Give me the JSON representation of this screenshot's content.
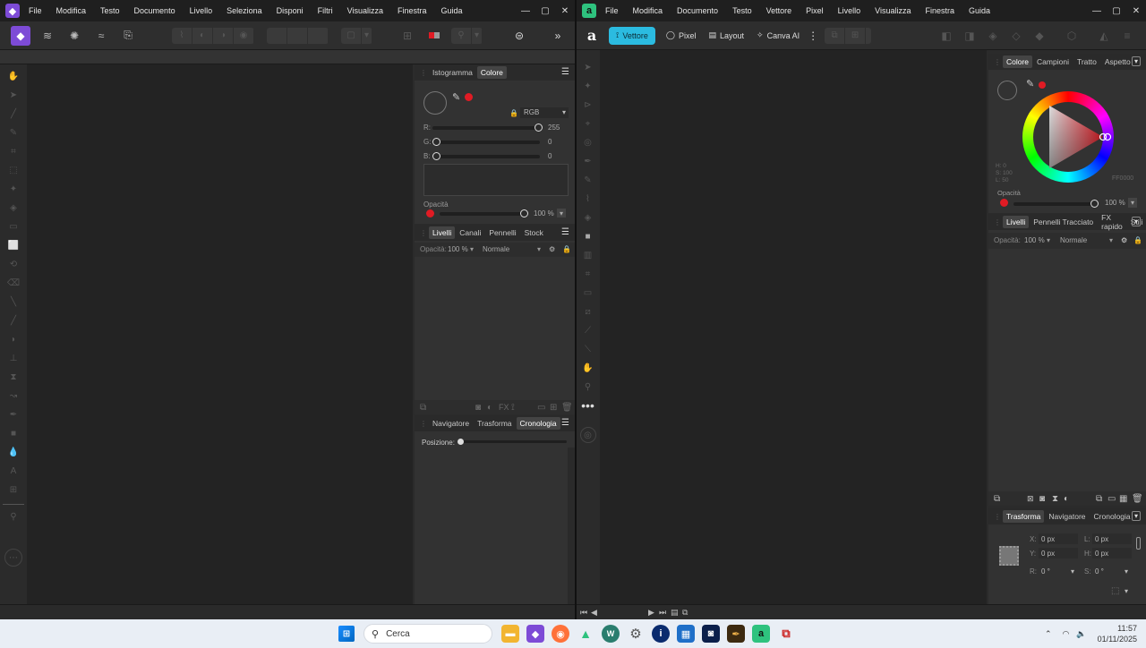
{
  "photo": {
    "menu": [
      "File",
      "Modifica",
      "Testo",
      "Documento",
      "Livello",
      "Seleziona",
      "Disponi",
      "Filtri",
      "Visualizza",
      "Finestra",
      "Guida"
    ],
    "color_panel_tabs": [
      "Istogramma",
      "Colore"
    ],
    "color_mode": "RGB",
    "r_label": "R:",
    "r_value": "255",
    "g_label": "G:",
    "g_value": "0",
    "b_label": "B:",
    "b_value": "0",
    "opacity_label": "Opacità",
    "opacity_value": "100 %",
    "layers_tabs": [
      "Livelli",
      "Canali",
      "Pennelli",
      "Stock"
    ],
    "layers_opacity_label": "Opacità:",
    "layers_opacity_value": "100 %",
    "blend_mode": "Normale",
    "history_tabs": [
      "Navigatore",
      "Trasforma",
      "Cronologia"
    ],
    "position_label": "Posizione:"
  },
  "designer": {
    "menu": [
      "File",
      "Modifica",
      "Documento",
      "Testo",
      "Vettore",
      "Pixel",
      "Livello",
      "Visualizza",
      "Finestra",
      "Guida"
    ],
    "personas": [
      "Vettore",
      "Pixel",
      "Layout",
      "Canva AI"
    ],
    "color_tabs": [
      "Colore",
      "Campioni",
      "Tratto",
      "Aspetto"
    ],
    "hsl_h": "H: 0",
    "hsl_s": "S: 100",
    "hsl_l": "L: 50",
    "hex": "FF0000",
    "opacity_label": "Opacità",
    "opacity_value": "100 %",
    "layers_tabs": [
      "Livelli",
      "Pennelli",
      "Tracciato",
      "FX rapido",
      "Stili"
    ],
    "layers_opacity_label": "Opacità:",
    "layers_opacity_value": "100 %",
    "blend_mode": "Normale",
    "transform_tabs": [
      "Trasforma",
      "Navigatore",
      "Cronologia"
    ],
    "x_label": "X:",
    "x_value": "0 px",
    "y_label": "Y:",
    "y_value": "0 px",
    "w_label": "L:",
    "w_value": "0 px",
    "h_label": "H:",
    "h_value": "0 px",
    "r_label": "R:",
    "r_value": "0 °",
    "s_label": "S:",
    "s_value": "0 °"
  },
  "taskbar": {
    "search_placeholder": "Cerca",
    "time": "11:57",
    "date": "01/11/2025"
  },
  "colors": {
    "accent_photo": "#7d4bd6",
    "accent_designer": "#2ec27e",
    "persona_active": "#2bbbe0",
    "swatch": "#e01b24"
  }
}
